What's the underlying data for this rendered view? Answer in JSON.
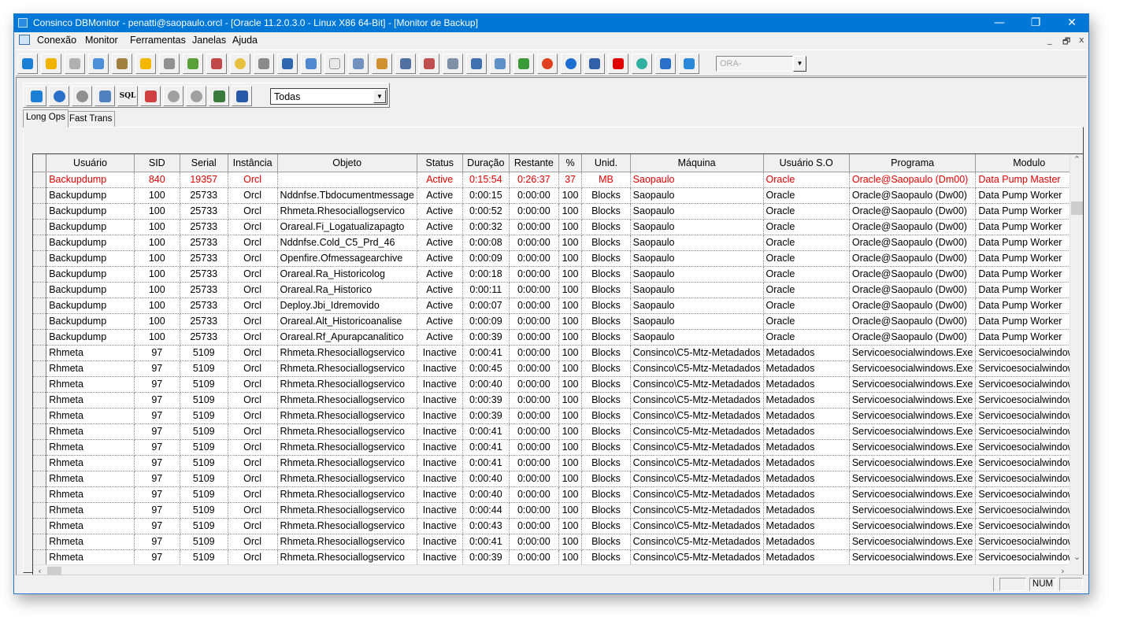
{
  "window": {
    "title": "Consinco DBMonitor - penatti@saopaulo.orcl - [Oracle 11.2.0.3.0 - Linux X86 64-Bit] - [Monitor de Backup]",
    "minimize": "—",
    "restore": "❐",
    "close": "✕"
  },
  "menu": {
    "items": [
      "Conexão",
      "Monitor",
      "Ferramentas",
      "Janelas",
      "Ajuda"
    ],
    "mdi_min": "_",
    "mdi_restore": "🗗",
    "mdi_close": "x"
  },
  "toolbar": {
    "db_select_value": "ORA-",
    "db_select_arrow": "▼"
  },
  "subtoolbar": {
    "sql_label": "SQL",
    "filter_value": "Todas",
    "filter_arrow": "▼"
  },
  "tabs": [
    "Long Ops",
    "Fast Trans"
  ],
  "grid": {
    "columns": [
      "Usuário",
      "SID",
      "Serial",
      "Instância",
      "Objeto",
      "Status",
      "Duração",
      "Restante",
      "%",
      "Unid.",
      "Máquina",
      "Usuário S.O",
      "Programa",
      "Modulo"
    ],
    "rows": [
      [
        "Backupdump",
        "840",
        "19357",
        "Orcl",
        "",
        "Active",
        "0:15:54",
        "0:26:37",
        "37",
        "MB",
        "Saopaulo",
        "Oracle",
        "Oracle@Saopaulo (Dm00)",
        "Data Pump Master"
      ],
      [
        "Backupdump",
        "100",
        "25733",
        "Orcl",
        "Nddnfse.Tbdocumentmessage",
        "Active",
        "0:00:15",
        "0:00:00",
        "100",
        "Blocks",
        "Saopaulo",
        "Oracle",
        "Oracle@Saopaulo (Dw00)",
        "Data Pump Worker"
      ],
      [
        "Backupdump",
        "100",
        "25733",
        "Orcl",
        "Rhmeta.Rhesociallogservico",
        "Active",
        "0:00:52",
        "0:00:00",
        "100",
        "Blocks",
        "Saopaulo",
        "Oracle",
        "Oracle@Saopaulo (Dw00)",
        "Data Pump Worker"
      ],
      [
        "Backupdump",
        "100",
        "25733",
        "Orcl",
        "Orareal.Fi_Logatualizapagto",
        "Active",
        "0:00:32",
        "0:00:00",
        "100",
        "Blocks",
        "Saopaulo",
        "Oracle",
        "Oracle@Saopaulo (Dw00)",
        "Data Pump Worker"
      ],
      [
        "Backupdump",
        "100",
        "25733",
        "Orcl",
        "Nddnfse.Cold_C5_Prd_46",
        "Active",
        "0:00:08",
        "0:00:00",
        "100",
        "Blocks",
        "Saopaulo",
        "Oracle",
        "Oracle@Saopaulo (Dw00)",
        "Data Pump Worker"
      ],
      [
        "Backupdump",
        "100",
        "25733",
        "Orcl",
        "Openfire.Ofmessagearchive",
        "Active",
        "0:00:09",
        "0:00:00",
        "100",
        "Blocks",
        "Saopaulo",
        "Oracle",
        "Oracle@Saopaulo (Dw00)",
        "Data Pump Worker"
      ],
      [
        "Backupdump",
        "100",
        "25733",
        "Orcl",
        "Orareal.Ra_Historicolog",
        "Active",
        "0:00:18",
        "0:00:00",
        "100",
        "Blocks",
        "Saopaulo",
        "Oracle",
        "Oracle@Saopaulo (Dw00)",
        "Data Pump Worker"
      ],
      [
        "Backupdump",
        "100",
        "25733",
        "Orcl",
        "Orareal.Ra_Historico",
        "Active",
        "0:00:11",
        "0:00:00",
        "100",
        "Blocks",
        "Saopaulo",
        "Oracle",
        "Oracle@Saopaulo (Dw00)",
        "Data Pump Worker"
      ],
      [
        "Backupdump",
        "100",
        "25733",
        "Orcl",
        "Deploy.Jbi_Idremovido",
        "Active",
        "0:00:07",
        "0:00:00",
        "100",
        "Blocks",
        "Saopaulo",
        "Oracle",
        "Oracle@Saopaulo (Dw00)",
        "Data Pump Worker"
      ],
      [
        "Backupdump",
        "100",
        "25733",
        "Orcl",
        "Orareal.Alt_Historicoanalise",
        "Active",
        "0:00:09",
        "0:00:00",
        "100",
        "Blocks",
        "Saopaulo",
        "Oracle",
        "Oracle@Saopaulo (Dw00)",
        "Data Pump Worker"
      ],
      [
        "Backupdump",
        "100",
        "25733",
        "Orcl",
        "Orareal.Rf_Apurapcanalitico",
        "Active",
        "0:00:39",
        "0:00:00",
        "100",
        "Blocks",
        "Saopaulo",
        "Oracle",
        "Oracle@Saopaulo (Dw00)",
        "Data Pump Worker"
      ],
      [
        "Rhmeta",
        "97",
        "5109",
        "Orcl",
        "Rhmeta.Rhesociallogservico",
        "Inactive",
        "0:00:41",
        "0:00:00",
        "100",
        "Blocks",
        "Consinco\\C5-Mtz-Metadados",
        "Metadados",
        "Servicoesocialwindows.Exe",
        "Servicoesocialwindows"
      ],
      [
        "Rhmeta",
        "97",
        "5109",
        "Orcl",
        "Rhmeta.Rhesociallogservico",
        "Inactive",
        "0:00:45",
        "0:00:00",
        "100",
        "Blocks",
        "Consinco\\C5-Mtz-Metadados",
        "Metadados",
        "Servicoesocialwindows.Exe",
        "Servicoesocialwindows"
      ],
      [
        "Rhmeta",
        "97",
        "5109",
        "Orcl",
        "Rhmeta.Rhesociallogservico",
        "Inactive",
        "0:00:40",
        "0:00:00",
        "100",
        "Blocks",
        "Consinco\\C5-Mtz-Metadados",
        "Metadados",
        "Servicoesocialwindows.Exe",
        "Servicoesocialwindows"
      ],
      [
        "Rhmeta",
        "97",
        "5109",
        "Orcl",
        "Rhmeta.Rhesociallogservico",
        "Inactive",
        "0:00:39",
        "0:00:00",
        "100",
        "Blocks",
        "Consinco\\C5-Mtz-Metadados",
        "Metadados",
        "Servicoesocialwindows.Exe",
        "Servicoesocialwindows"
      ],
      [
        "Rhmeta",
        "97",
        "5109",
        "Orcl",
        "Rhmeta.Rhesociallogservico",
        "Inactive",
        "0:00:39",
        "0:00:00",
        "100",
        "Blocks",
        "Consinco\\C5-Mtz-Metadados",
        "Metadados",
        "Servicoesocialwindows.Exe",
        "Servicoesocialwindows"
      ],
      [
        "Rhmeta",
        "97",
        "5109",
        "Orcl",
        "Rhmeta.Rhesociallogservico",
        "Inactive",
        "0:00:41",
        "0:00:00",
        "100",
        "Blocks",
        "Consinco\\C5-Mtz-Metadados",
        "Metadados",
        "Servicoesocialwindows.Exe",
        "Servicoesocialwindows"
      ],
      [
        "Rhmeta",
        "97",
        "5109",
        "Orcl",
        "Rhmeta.Rhesociallogservico",
        "Inactive",
        "0:00:41",
        "0:00:00",
        "100",
        "Blocks",
        "Consinco\\C5-Mtz-Metadados",
        "Metadados",
        "Servicoesocialwindows.Exe",
        "Servicoesocialwindows"
      ],
      [
        "Rhmeta",
        "97",
        "5109",
        "Orcl",
        "Rhmeta.Rhesociallogservico",
        "Inactive",
        "0:00:41",
        "0:00:00",
        "100",
        "Blocks",
        "Consinco\\C5-Mtz-Metadados",
        "Metadados",
        "Servicoesocialwindows.Exe",
        "Servicoesocialwindows"
      ],
      [
        "Rhmeta",
        "97",
        "5109",
        "Orcl",
        "Rhmeta.Rhesociallogservico",
        "Inactive",
        "0:00:40",
        "0:00:00",
        "100",
        "Blocks",
        "Consinco\\C5-Mtz-Metadados",
        "Metadados",
        "Servicoesocialwindows.Exe",
        "Servicoesocialwindows"
      ],
      [
        "Rhmeta",
        "97",
        "5109",
        "Orcl",
        "Rhmeta.Rhesociallogservico",
        "Inactive",
        "0:00:40",
        "0:00:00",
        "100",
        "Blocks",
        "Consinco\\C5-Mtz-Metadados",
        "Metadados",
        "Servicoesocialwindows.Exe",
        "Servicoesocialwindows"
      ],
      [
        "Rhmeta",
        "97",
        "5109",
        "Orcl",
        "Rhmeta.Rhesociallogservico",
        "Inactive",
        "0:00:44",
        "0:00:00",
        "100",
        "Blocks",
        "Consinco\\C5-Mtz-Metadados",
        "Metadados",
        "Servicoesocialwindows.Exe",
        "Servicoesocialwindows"
      ],
      [
        "Rhmeta",
        "97",
        "5109",
        "Orcl",
        "Rhmeta.Rhesociallogservico",
        "Inactive",
        "0:00:43",
        "0:00:00",
        "100",
        "Blocks",
        "Consinco\\C5-Mtz-Metadados",
        "Metadados",
        "Servicoesocialwindows.Exe",
        "Servicoesocialwindows"
      ],
      [
        "Rhmeta",
        "97",
        "5109",
        "Orcl",
        "Rhmeta.Rhesociallogservico",
        "Inactive",
        "0:00:41",
        "0:00:00",
        "100",
        "Blocks",
        "Consinco\\C5-Mtz-Metadados",
        "Metadados",
        "Servicoesocialwindows.Exe",
        "Servicoesocialwindows"
      ],
      [
        "Rhmeta",
        "97",
        "5109",
        "Orcl",
        "Rhmeta.Rhesociallogservico",
        "Inactive",
        "0:00:39",
        "0:00:00",
        "100",
        "Blocks",
        "Consinco\\C5-Mtz-Metadados",
        "Metadados",
        "Servicoesocialwindows.Exe",
        "Servicoesocialwindows"
      ]
    ],
    "highlight_color": "#e00000",
    "scroll_up": "⌃",
    "scroll_down": "⌄",
    "scroll_left": "‹",
    "scroll_right": "›"
  },
  "statusbar": {
    "num": "NUM"
  },
  "colors": {
    "titlebar": "#0078d7",
    "highlight_row": "#e00000"
  }
}
